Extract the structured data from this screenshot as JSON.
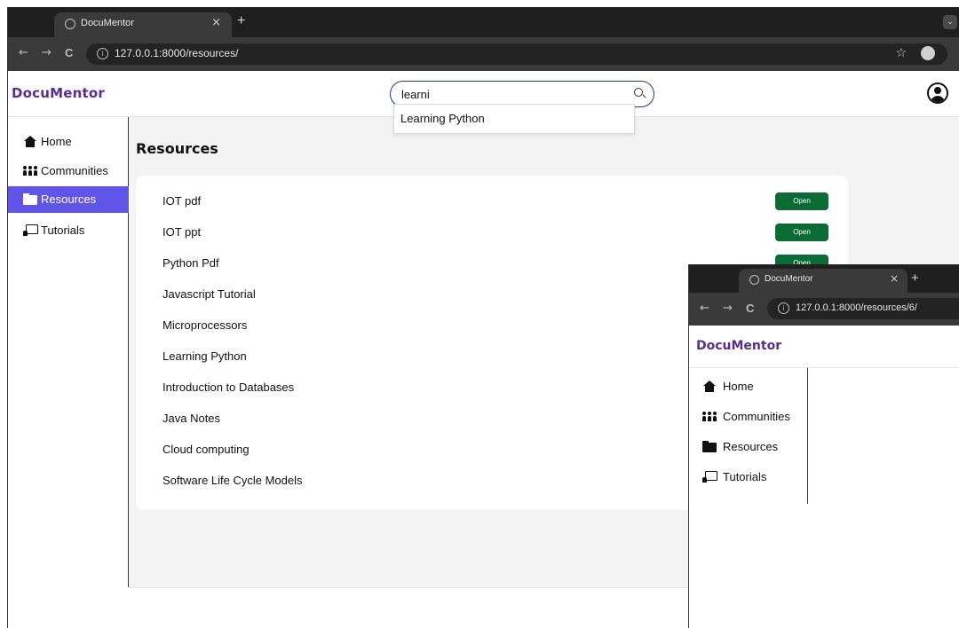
{
  "main_window": {
    "tab": {
      "title": "DocuMentor",
      "close": "×"
    },
    "new_tab": "+",
    "tab_menu": "⌄",
    "toolbar": {
      "back": "←",
      "forward": "→",
      "reload": "C",
      "url": "127.0.0.1:8000/resources/",
      "info": "i",
      "star": "☆",
      "more": "⋮"
    },
    "app": {
      "brand": "DocuMentor",
      "search": {
        "value": "learni",
        "placeholder": ""
      },
      "suggestions": [
        "Learning Python"
      ],
      "sidebar": [
        {
          "label": "Home",
          "icon": "home-icon",
          "active": false
        },
        {
          "label": "Communities",
          "icon": "people-icon",
          "active": false
        },
        {
          "label": "Resources",
          "icon": "folder-icon",
          "active": true
        },
        {
          "label": "Tutorials",
          "icon": "chalkboard-teacher-icon",
          "active": false
        }
      ],
      "content": {
        "title": "Resources",
        "open_label": "Open",
        "resources": [
          {
            "name": "IOT pdf",
            "has_open": true
          },
          {
            "name": "IOT ppt",
            "has_open": true
          },
          {
            "name": "Python Pdf",
            "has_open": true
          },
          {
            "name": "Javascript Tutorial",
            "has_open": false
          },
          {
            "name": "Microprocessors",
            "has_open": false
          },
          {
            "name": "Learning Python",
            "has_open": false
          },
          {
            "name": "Introduction to Databases",
            "has_open": false
          },
          {
            "name": "Java Notes",
            "has_open": false
          },
          {
            "name": "Cloud computing",
            "has_open": false
          },
          {
            "name": "Software Life Cycle Models",
            "has_open": false
          }
        ]
      }
    }
  },
  "overlay_window": {
    "tab": {
      "title": "DocuMentor",
      "close": "×"
    },
    "new_tab": "+",
    "toolbar": {
      "back": "←",
      "forward": "→",
      "reload": "C",
      "url": "127.0.0.1:8000/resources/6/",
      "info": "i"
    },
    "app": {
      "brand": "DocuMentor",
      "sidebar": [
        {
          "label": "Home",
          "icon": "home-icon"
        },
        {
          "label": "Communities",
          "icon": "people-icon"
        },
        {
          "label": "Resources",
          "icon": "folder-icon"
        },
        {
          "label": "Tutorials",
          "icon": "chalkboard-teacher-icon"
        }
      ]
    }
  },
  "colors": {
    "brand": "#5b2d8e",
    "active_nav": "#6155e8",
    "open_button": "#0b6b35",
    "search_border": "#1f3a8a",
    "content_bg": "#f3f3f3"
  }
}
